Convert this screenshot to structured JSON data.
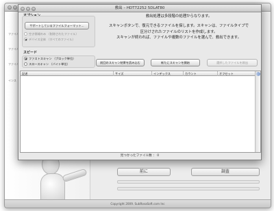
{
  "background_app": {
    "side_texts": [
      "ファイル",
      "ファイル",
      "ファイル",
      "インス"
    ],
    "buttons": {
      "back_label": "前に",
      "scan_label": "調査"
    },
    "footer": "Copyright 2009. SubRosaSoft.com Inc"
  },
  "window": {
    "title": "救出 – HDT72252 5DLAT80"
  },
  "options": {
    "section_label": "オプション",
    "file_formats_button": "サポートしているファイルフォーマット...",
    "radio_deleted_only": "空き領域のみ （削除されたファイル）",
    "radio_whole_device": "デバイス全体 （すべてのファイル）"
  },
  "speed": {
    "section_label": "スピード",
    "radio_fast": "ファストスキャン （ブロック単位）",
    "radio_slow": "スロースキャン （バイト単位）"
  },
  "description": {
    "line1": "救出処理は多段階の処理からなります。",
    "line2": "スキャンボタンで、復元できるファイルを探します。スキャンは、ファイルタイプで",
    "line3": "区分けされたファイルのリストを作成します。",
    "line4": "スキャンが終われば、ファイルや複数のファイルを選んで、救出できます。"
  },
  "actions": {
    "load_previous_scan": "前回のスキャン結果を読み込む",
    "start_new_scan": "新たにスキャンを開始",
    "recover_selected": "選択したファイルを救出"
  },
  "table": {
    "columns": [
      "記述",
      "サイズ",
      "インデックス",
      "カウント",
      "オフセット"
    ],
    "rows": []
  },
  "status": {
    "found_files": "見つかったファイル数 ： 0"
  }
}
